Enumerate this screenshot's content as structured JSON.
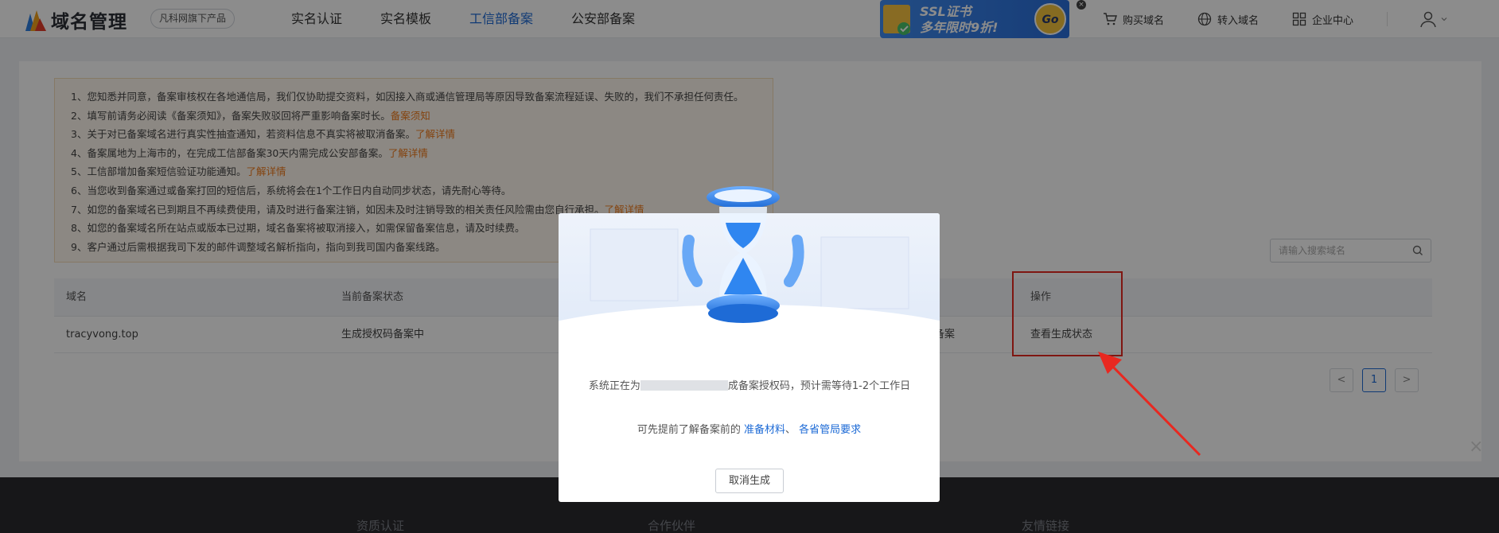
{
  "header": {
    "logo_text": "域名管理",
    "brand_tag": "凡科网旗下产品",
    "nav": [
      "实名认证",
      "实名模板",
      "工信部备案",
      "公安部备案"
    ],
    "active_nav": 2,
    "banner": {
      "line1": "SSL证书",
      "line2": "多年限时9折!",
      "go": "Go"
    },
    "banner_close": "×",
    "links": [
      {
        "label": "购买域名",
        "icon": "cart-icon"
      },
      {
        "label": "转入域名",
        "icon": "globe-icon"
      },
      {
        "label": "企业中心",
        "icon": "apps-icon"
      }
    ],
    "user_icon": "user-icon"
  },
  "notice": {
    "lines": [
      {
        "text": "1、您知悉并同意，备案审核权在各地通信局，我们仅协助提交资料，如因接入商或通信管理局等原因导致备案流程延误、失败的，我们不承担任何责任。",
        "link": ""
      },
      {
        "text": "2、填写前请务必阅读《备案须知》，备案失败驳回将严重影响备案时长。",
        "link": "备案须知"
      },
      {
        "text": "3、关于对已备案域名进行真实性抽查通知，若资料信息不真实将被取消备案。",
        "link": "了解详情"
      },
      {
        "text": "4、备案属地为上海市的，在完成工信部备案30天内需完成公安部备案。",
        "link": "了解详情"
      },
      {
        "text": "5、工信部增加备案短信验证功能通知。",
        "link": "了解详情"
      },
      {
        "text": "6、当您收到备案通过或备案打回的短信后，系统将会在1个工作日内自动同步状态，请先耐心等待。",
        "link": ""
      },
      {
        "text": "7、如您的备案域名已到期且不再续费使用，请及时进行备案注销，如因未及时注销导致的相关责任风险需由您自行承担。",
        "link": "了解详情"
      },
      {
        "text": "8、如您的备案域名所在站点或版本已过期，域名备案将被取消接入，如需保留备案信息，请及时续费。",
        "link": ""
      },
      {
        "text": "9、客户通过后需根据我司下发的邮件调整域名解析指向，指向到我司国内备案线路。",
        "link": ""
      }
    ]
  },
  "search": {
    "placeholder": "请输入搜索域名"
  },
  "table": {
    "headers": {
      "domain": "域名",
      "status": "当前备案状态",
      "op": "操作"
    },
    "row": {
      "domain": "tracyvong.top",
      "status": "生成授权码备案中",
      "partial": "备案",
      "op": "查看生成状态"
    }
  },
  "pager": {
    "prev": "<",
    "current": "1",
    "next": ">"
  },
  "footer": {
    "col1": "资质认证",
    "col2": "合作伙伴",
    "col3": "友情链接"
  },
  "modal": {
    "close": "×",
    "text_before": "系统正在为",
    "text_after": "成备案授权码，预计需等待1-2个工作日",
    "hint": "可先提前了解备案前的",
    "link1": "准备材料",
    "separator": "、",
    "link2": "各省管局要求",
    "cancel": "取消生成"
  },
  "colors": {
    "accent": "#1e6bd6",
    "warn_link": "#f07b1d",
    "highlight": "#e82820"
  }
}
